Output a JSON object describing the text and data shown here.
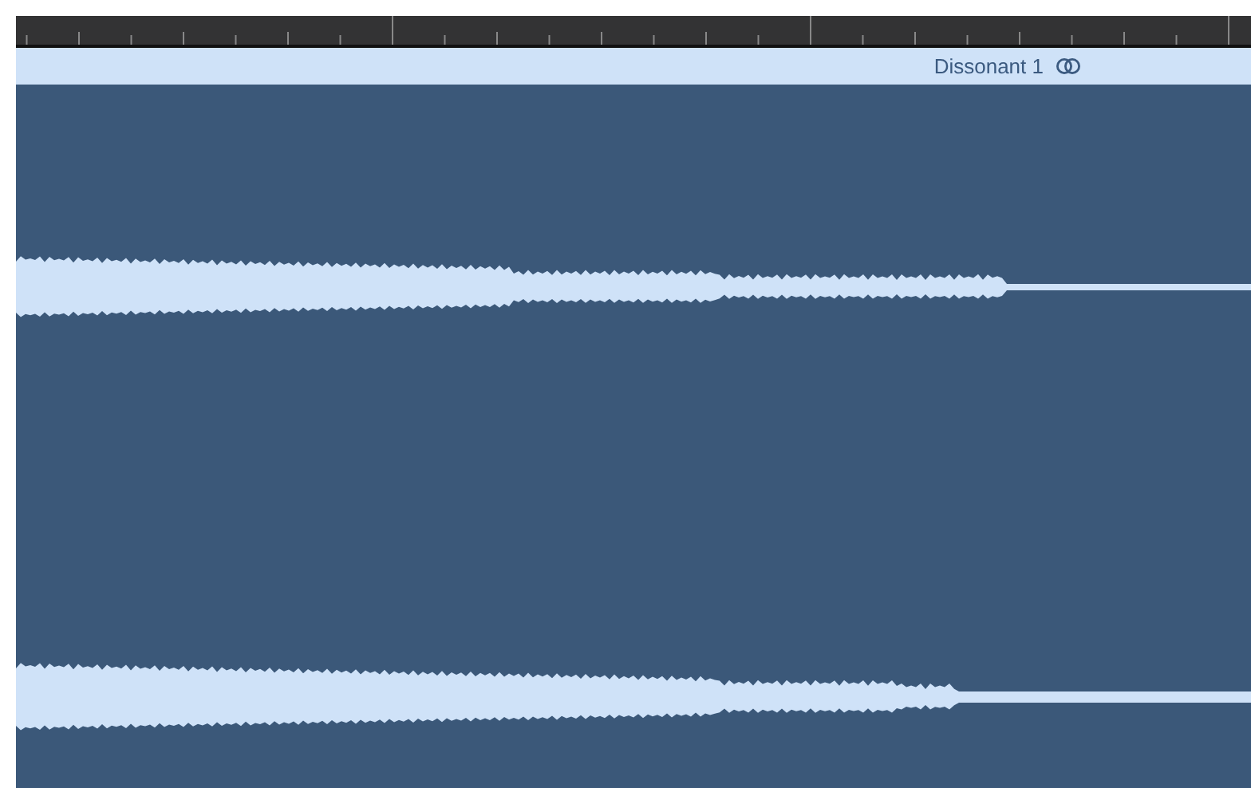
{
  "region": {
    "name": "Dissonant 1",
    "looped": true
  }
}
